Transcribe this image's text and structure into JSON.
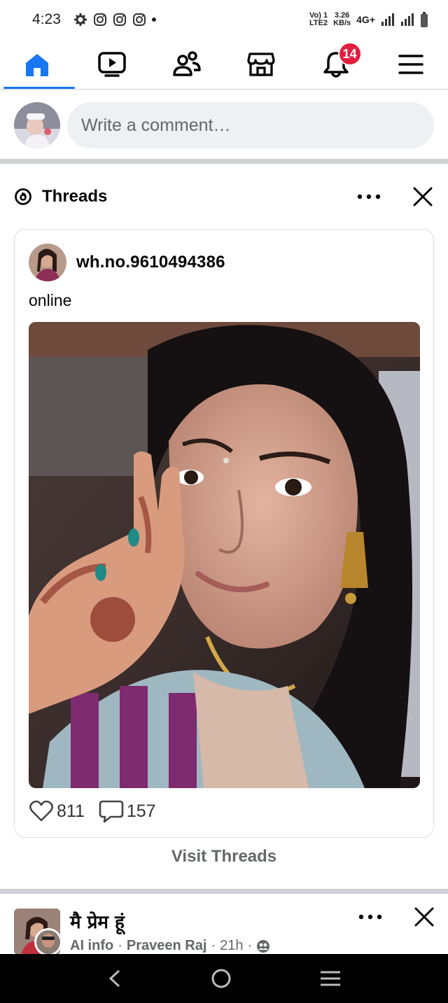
{
  "status_bar": {
    "time": "4:23",
    "volte_line1": "Vo) 1",
    "volte_line2": "LTE2",
    "speed_value": "3.26",
    "speed_unit": "KB/s",
    "network": "4G+"
  },
  "nav": {
    "items": [
      {
        "name": "home",
        "icon": "home-icon",
        "active": true
      },
      {
        "name": "video",
        "icon": "video-icon"
      },
      {
        "name": "friends",
        "icon": "friends-icon"
      },
      {
        "name": "marketplace",
        "icon": "marketplace-icon"
      },
      {
        "name": "notifications",
        "icon": "bell-icon"
      },
      {
        "name": "menu",
        "icon": "menu-icon"
      }
    ],
    "notification_count": "14"
  },
  "composer": {
    "placeholder": "Write a comment…"
  },
  "threads_card": {
    "title": "Threads",
    "username": "wh.no.9610494386",
    "post_text": "online",
    "likes": "811",
    "comments": "157",
    "visit_label": "Visit Threads"
  },
  "next_post": {
    "title": "मै प्रेम हूं",
    "meta_tag": "AI info",
    "meta_author": "Praveen Raj",
    "meta_time": "21h"
  },
  "colors": {
    "accent": "#1877f2",
    "badge": "#e41e3f",
    "divider": "#ced0d4"
  }
}
